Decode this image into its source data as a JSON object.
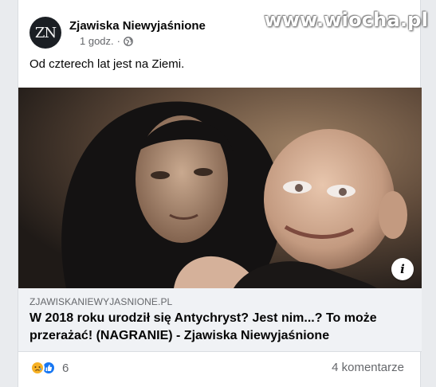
{
  "watermark": "www.wiocha.pl",
  "post": {
    "avatar_initials": "ZN",
    "page_name": "Zjawiska Niewyjaśnione",
    "time": "1 godz.",
    "audience_icon": "globe-icon",
    "separator": "·",
    "text": "Od czterech lat jest na Ziemi."
  },
  "link_preview": {
    "info_icon": "i",
    "domain": "ZJAWISKANIEWYJASNIONE.PL",
    "title": "W 2018 roku urodził się Antychryst? Jest nim...? To może przerażać! (NAGRANIE) - Zjawiska Niewyjaśnione"
  },
  "footer": {
    "reaction_icons": [
      "sad-reaction-icon",
      "like-reaction-icon"
    ],
    "reaction_count": "6",
    "comments": "4 komentarze"
  },
  "colors": {
    "background": "#e9ebee",
    "card": "#ffffff",
    "link_box": "#f0f2f5",
    "secondary_text": "#65676b",
    "like_blue": "#1877f2",
    "sad_yellow": "#f7b125"
  }
}
